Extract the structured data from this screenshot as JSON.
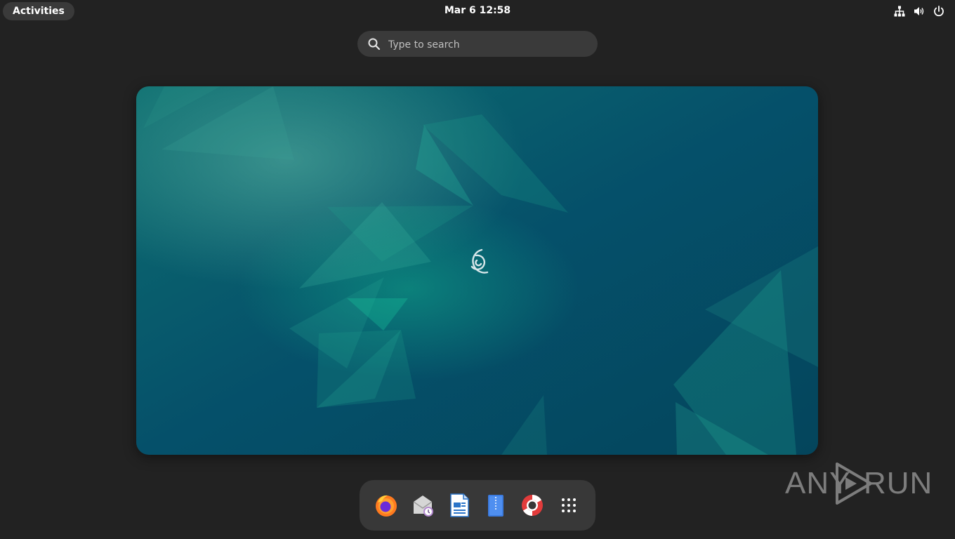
{
  "topbar": {
    "activities_label": "Activities",
    "clock": "Mar 6  12:58",
    "tray_icons": [
      "network-icon",
      "volume-icon",
      "power-icon"
    ]
  },
  "search": {
    "placeholder": "Type to search"
  },
  "workspace": {
    "wallpaper": "debian-emerald",
    "logo": "debian-swirl-icon"
  },
  "dash": {
    "apps": [
      {
        "name": "Firefox",
        "icon": "firefox-icon"
      },
      {
        "name": "Evolution",
        "icon": "evolution-mail-icon"
      },
      {
        "name": "LibreOffice Writer",
        "icon": "writer-icon"
      },
      {
        "name": "Archive Manager",
        "icon": "archive-icon"
      },
      {
        "name": "Help",
        "icon": "help-icon"
      },
      {
        "name": "Show Applications",
        "icon": "app-grid-icon"
      }
    ]
  },
  "watermark": {
    "left_text": "ANY",
    "right_text": "RUN"
  },
  "colors": {
    "panel": "#222222",
    "pill": "#3a3a3a",
    "dash": "#383838",
    "wallpaper_base": "#064a5f",
    "wallpaper_accent": "#16a08a"
  }
}
